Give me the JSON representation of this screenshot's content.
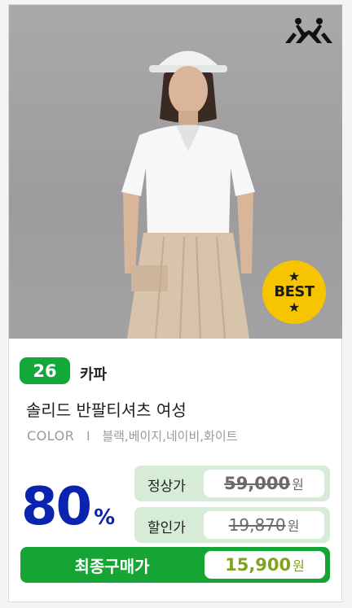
{
  "badge": {
    "star": "★",
    "text": "BEST"
  },
  "product": {
    "rank": "26",
    "brand": "카파",
    "name": "솔리드 반팔티셔츠 여성",
    "color_label": "COLOR",
    "color_sep": "I",
    "colors": "블랙,베이지,네이비,화이트"
  },
  "pricing": {
    "discount": "80",
    "discount_unit": "%",
    "regular_label": "정상가",
    "regular_price": "59,000",
    "sale_label": "할인가",
    "sale_price": "19,870",
    "final_label": "최종구매가",
    "final_price": "15,900",
    "currency": "원"
  },
  "colors_theme": {
    "green": "#16a534",
    "light_green": "#d6ecd6",
    "discount_blue": "#0a24b0",
    "best_yellow": "#f6c400"
  },
  "icons": [
    "kappa-logo-icon"
  ]
}
